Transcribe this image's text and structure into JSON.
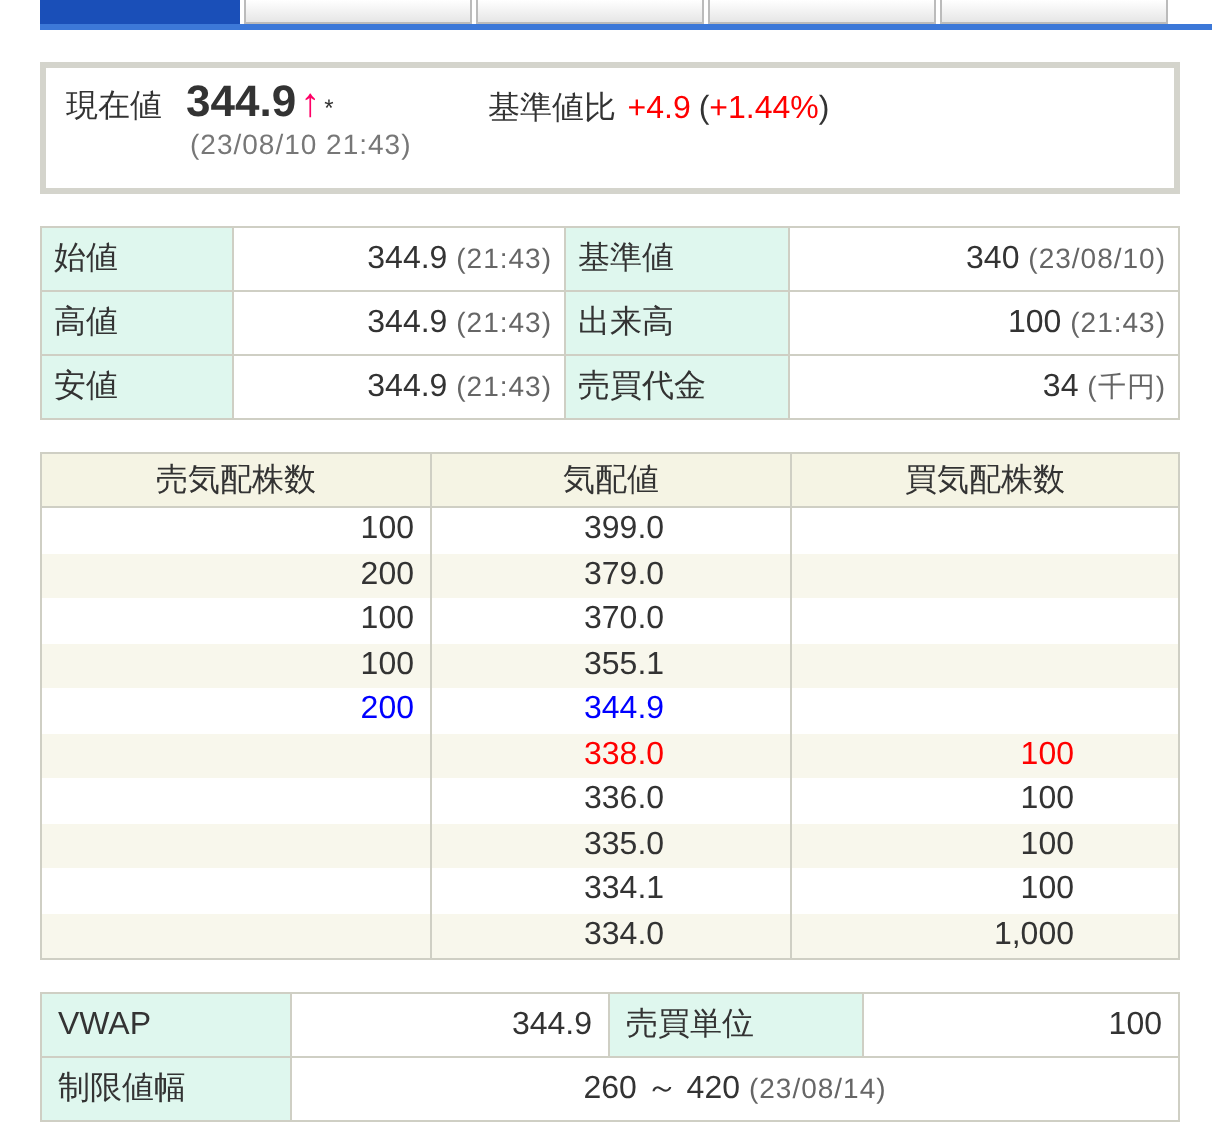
{
  "tabs": [
    {
      "selected": true
    },
    {
      "selected": false
    },
    {
      "selected": false
    },
    {
      "selected": false
    },
    {
      "selected": false
    }
  ],
  "quote": {
    "label": "現在値",
    "price": "344.9",
    "arrow": "↑",
    "mark": "*",
    "time": "(23/08/10 21:43)",
    "change_label": "基準値比",
    "change": "+4.9",
    "change_pct": "(+1.44%)"
  },
  "summary": [
    {
      "label": "始値",
      "value": "344.9",
      "note": "(21:43)",
      "label2": "基準値",
      "value2": "340",
      "note2": "(23/08/10)"
    },
    {
      "label": "高値",
      "value": "344.9",
      "note": "(21:43)",
      "label2": "出来高",
      "value2": "100",
      "note2": "(21:43)"
    },
    {
      "label": "安値",
      "value": "344.9",
      "note": "(21:43)",
      "label2": "売買代金",
      "value2": "34",
      "note2": "(千円)"
    }
  ],
  "order_book": {
    "columns": [
      "売気配株数",
      "気配値",
      "買気配株数"
    ],
    "rows": [
      {
        "ask": "100",
        "price": "399.0"
      },
      {
        "ask": "200",
        "price": "379.0"
      },
      {
        "ask": "100",
        "price": "370.0"
      },
      {
        "ask": "100",
        "price": "355.1"
      },
      {
        "ask": "200",
        "price": "344.9",
        "color": "#0000ff"
      },
      {
        "price": "338.0",
        "bid": "100",
        "color": "#ff0000"
      },
      {
        "price": "336.0",
        "bid": "100"
      },
      {
        "price": "335.0",
        "bid": "100"
      },
      {
        "price": "334.1",
        "bid": "100"
      },
      {
        "price": "334.0",
        "bid": "1,000"
      }
    ]
  },
  "details": {
    "vwap_label": "VWAP",
    "vwap": "344.9",
    "unit_label": "売買単位",
    "unit": "100",
    "limit_label": "制限値幅",
    "limit": "260 ～ 420",
    "limit_note": "(23/08/14)"
  }
}
